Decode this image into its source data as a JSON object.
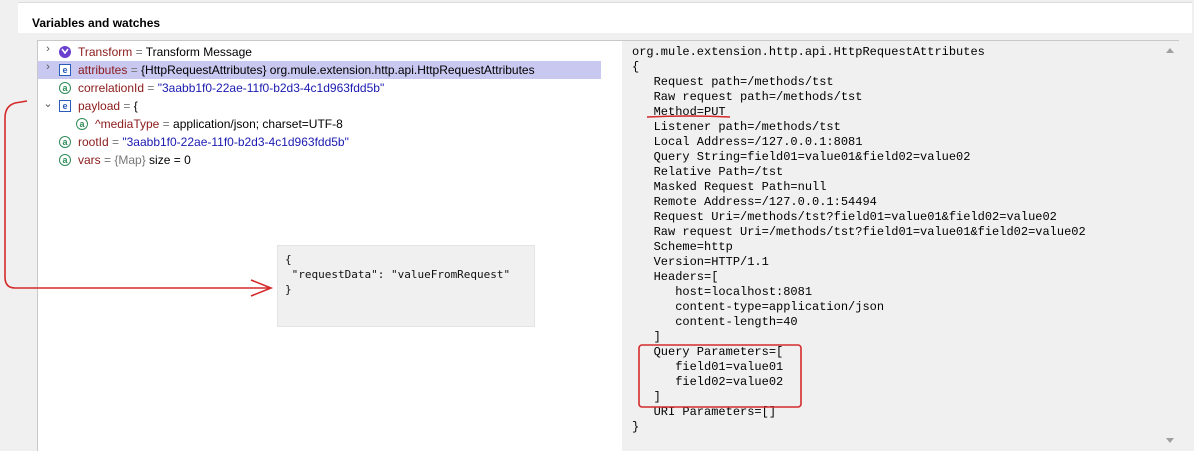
{
  "panel": {
    "title": "Variables and watches"
  },
  "tree": [
    {
      "name": "Transform",
      "eq": " = ",
      "value": "Transform Message",
      "icon": "dataweave-icon",
      "expanded": false
    },
    {
      "name": "attributes",
      "eq": " = ",
      "value": "{HttpRequestAttributes} org.mule.extension.http.api.HttpRequestAttributes",
      "icon": "entry-icon",
      "expanded": false,
      "selected": true
    },
    {
      "name": "correlationId",
      "eq": " = ",
      "value": "\"3aabb1f0-22ae-11f0-b2d3-4c1d963fdd5b\"",
      "icon": "attribute-icon"
    },
    {
      "name": "payload",
      "eq": " = ",
      "value": "{",
      "icon": "entry-icon",
      "expanded": true
    },
    {
      "name": "^mediaType",
      "eq": " = ",
      "value": "application/json; charset=UTF-8",
      "icon": "attribute-icon"
    },
    {
      "name": "rootId",
      "eq": " = ",
      "value": "\"3aabb1f0-22ae-11f0-b2d3-4c1d963fdd5b\"",
      "icon": "attribute-icon"
    },
    {
      "name": "vars",
      "eq": " = ",
      "type": "{Map}",
      "value": " size = 0",
      "icon": "attribute-icon"
    }
  ],
  "popup": {
    "lines": [
      "{",
      " \"requestData\": \"valueFromRequest\"",
      "}"
    ]
  },
  "detail": {
    "lines": [
      "org.mule.extension.http.api.HttpRequestAttributes",
      "{",
      "   Request path=/methods/tst",
      "   Raw request path=/methods/tst",
      "   Method=PUT",
      "   Listener path=/methods/tst",
      "   Local Address=/127.0.0.1:8081",
      "   Query String=field01=value01&field02=value02",
      "   Relative Path=/tst",
      "   Masked Request Path=null",
      "   Remote Address=/127.0.0.1:54494",
      "   Request Uri=/methods/tst?field01=value01&field02=value02",
      "   Raw request Uri=/methods/tst?field01=value01&field02=value02",
      "   Scheme=http",
      "   Version=HTTP/1.1",
      "   Headers=[",
      "      host=localhost:8081",
      "      content-type=application/json",
      "      content-length=40",
      "   ]",
      "   Query Parameters=[",
      "      field01=value01",
      "      field02=value02",
      "   ]",
      "   URI Parameters=[]",
      "}"
    ]
  },
  "colors": {
    "annotation": "#d42a2a",
    "selection": "#c8c8f0",
    "name": "#8b1a1a",
    "string": "#1a1ab0"
  }
}
